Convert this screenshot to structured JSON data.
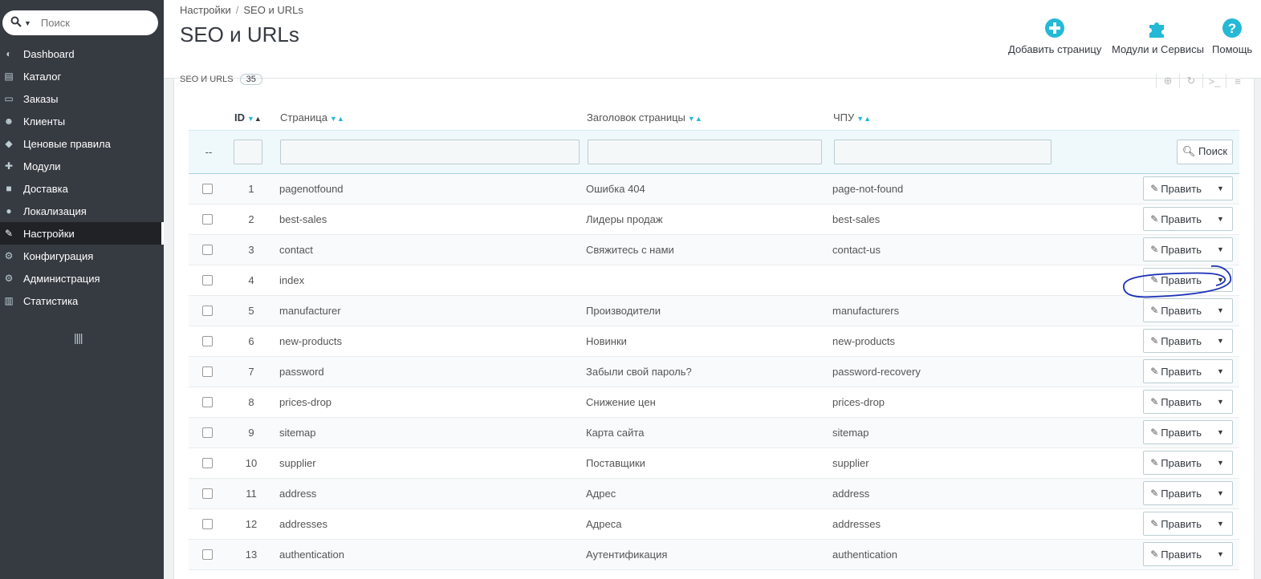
{
  "sidebar": {
    "search_placeholder": "Поиск",
    "items": [
      {
        "label": "Dashboard",
        "icon": "speedometer-icon"
      },
      {
        "label": "Каталог",
        "icon": "book-icon"
      },
      {
        "label": "Заказы",
        "icon": "credit-card-icon"
      },
      {
        "label": "Клиенты",
        "icon": "users-icon"
      },
      {
        "label": "Ценовые правила",
        "icon": "tags-icon"
      },
      {
        "label": "Модули",
        "icon": "puzzle-icon"
      },
      {
        "label": "Доставка",
        "icon": "truck-icon"
      },
      {
        "label": "Локализация",
        "icon": "globe-icon"
      },
      {
        "label": "Настройки",
        "icon": "wrench-icon",
        "active": true
      },
      {
        "label": "Конфигурация",
        "icon": "cogs-icon"
      },
      {
        "label": "Администрация",
        "icon": "cog-icon"
      },
      {
        "label": "Статистика",
        "icon": "bar-chart-icon"
      }
    ]
  },
  "header": {
    "breadcrumb": [
      "Настройки",
      "SEO и URLs"
    ],
    "breadcrumb_sep": "/",
    "title": "SEO и URLs",
    "toolbar": {
      "add_page": "Добавить страницу",
      "modules": "Модули и Сервисы",
      "help": "Помощь"
    },
    "accent_color": "#25b9d7"
  },
  "panel": {
    "heading": "SEO и URLs",
    "count": "35"
  },
  "table": {
    "columns": {
      "id": "ID",
      "page": "Страница",
      "title": "Заголовок страницы",
      "url": "ЧПУ"
    },
    "filter_dash": "--",
    "search_button": "Поиск",
    "edit_label": "Править",
    "rows": [
      {
        "id": "1",
        "page": "pagenotfound",
        "title": "Ошибка 404",
        "url": "page-not-found"
      },
      {
        "id": "2",
        "page": "best-sales",
        "title": "Лидеры продаж",
        "url": "best-sales"
      },
      {
        "id": "3",
        "page": "contact",
        "title": "Свяжитесь с нами",
        "url": "contact-us"
      },
      {
        "id": "4",
        "page": "index",
        "title": "",
        "url": ""
      },
      {
        "id": "5",
        "page": "manufacturer",
        "title": "Производители",
        "url": "manufacturers"
      },
      {
        "id": "6",
        "page": "new-products",
        "title": "Новинки",
        "url": "new-products"
      },
      {
        "id": "7",
        "page": "password",
        "title": "Забыли свой пароль?",
        "url": "password-recovery"
      },
      {
        "id": "8",
        "page": "prices-drop",
        "title": "Снижение цен",
        "url": "prices-drop"
      },
      {
        "id": "9",
        "page": "sitemap",
        "title": "Карта сайта",
        "url": "sitemap"
      },
      {
        "id": "10",
        "page": "supplier",
        "title": "Поставщики",
        "url": "supplier"
      },
      {
        "id": "11",
        "page": "address",
        "title": "Адрес",
        "url": "address"
      },
      {
        "id": "12",
        "page": "addresses",
        "title": "Адреса",
        "url": "addresses"
      },
      {
        "id": "13",
        "page": "authentication",
        "title": "Аутентификация",
        "url": "authentication"
      }
    ]
  }
}
